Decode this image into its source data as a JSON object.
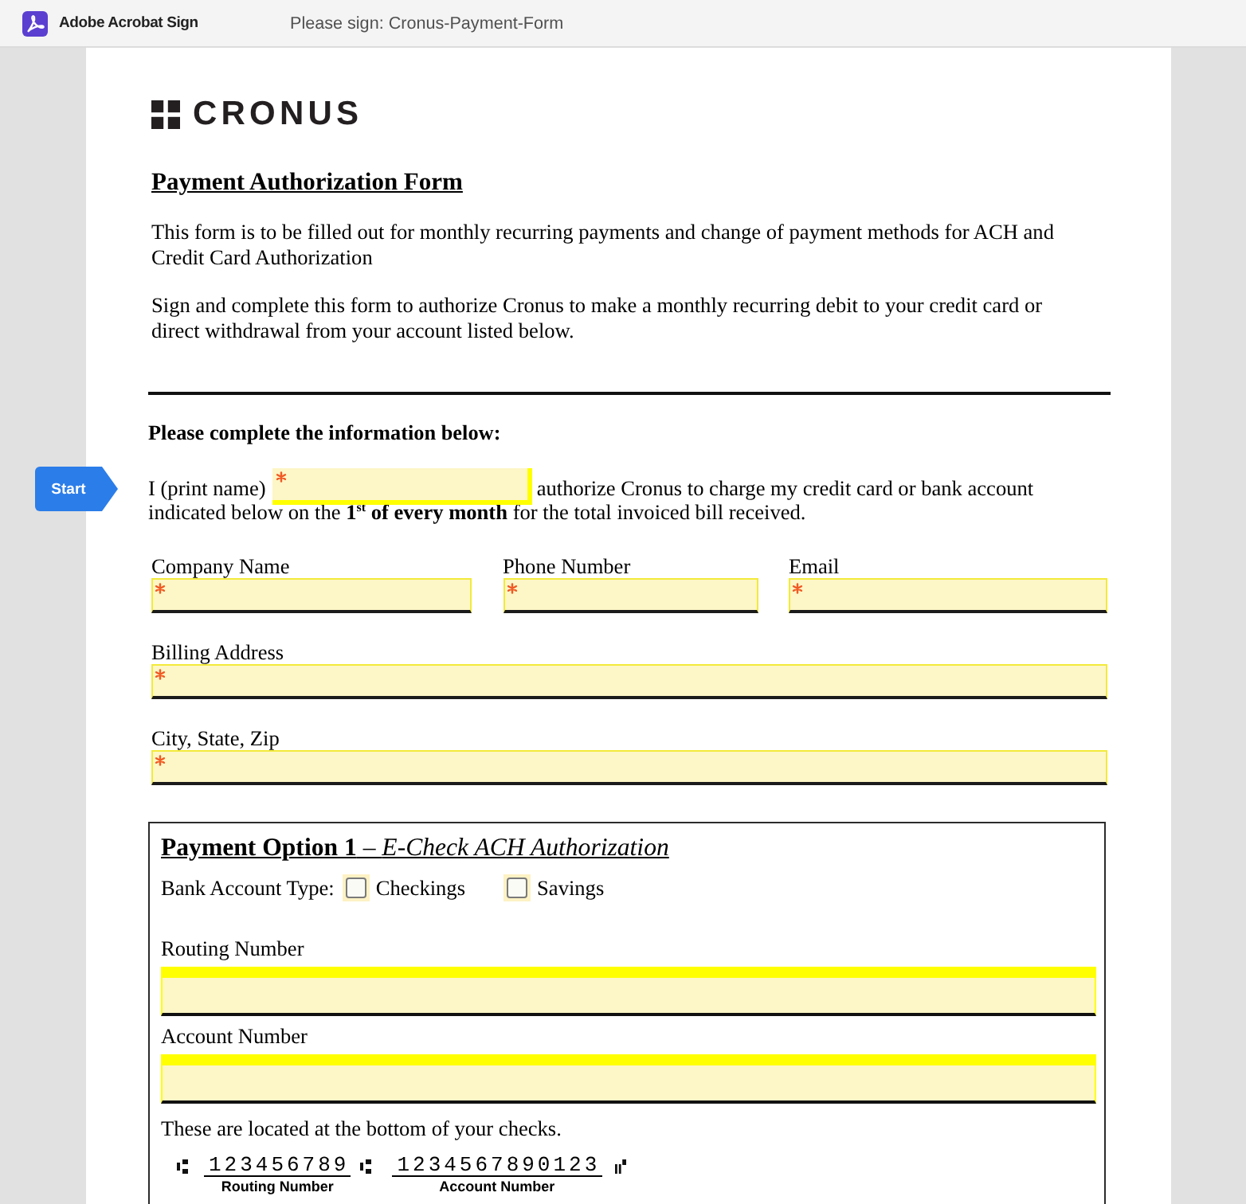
{
  "app_bar": {
    "app_name": "Adobe Acrobat Sign",
    "document_title": "Please sign: Cronus-Payment-Form"
  },
  "start_tag": {
    "label": "Start"
  },
  "document": {
    "logo": {
      "wordmark": "CRONUS"
    },
    "title": "Payment Authorization Form",
    "paragraphs": [
      "This form is to be filled out for monthly recurring payments and change of payment methods for ACH and Credit Card Authorization",
      "Sign and complete this form to authorize Cronus to make a monthly recurring debit to your credit card or direct withdrawal from your account listed below."
    ],
    "section_heading": "Please complete the information below:",
    "authorization": {
      "name_label": "I (print name)",
      "name_field": {
        "required": true
      },
      "line_1": "authorize Cronus to charge my credit card or bank account",
      "line_2": "indicated below on the **1$^{st}$ of every month** for the total invoiced bill received."
    },
    "field_rows": [
      [
        {
          "label": "Company Name",
          "required": true
        },
        {
          "label": "Phone Number",
          "required": true
        },
        {
          "label": "Email",
          "required": true
        }
      ],
      [
        {
          "label": "Billing Address",
          "required": true
        }
      ],
      [
        {
          "label": "City, State, Zip",
          "required": true
        }
      ]
    ],
    "payment_option": {
      "heading": "**Payment Option 1** – *E-Check ACH Authorization*",
      "account_type_label": "Bank Account Type:",
      "account_types": [
        {
          "label": "Checkings",
          "checked": false
        },
        {
          "label": "Savings",
          "checked": false
        }
      ],
      "fields": [
        {
          "label": "Routing Number",
          "required": false
        },
        {
          "label": "Account Number",
          "required": false
        }
      ],
      "note": "These are located at the bottom of your checks.",
      "check_line": {
        "routing_number": "123456789",
        "account_number": "1234567890123",
        "routing_caption": "Routing Number",
        "account_caption": "Account Number"
      }
    }
  }
}
